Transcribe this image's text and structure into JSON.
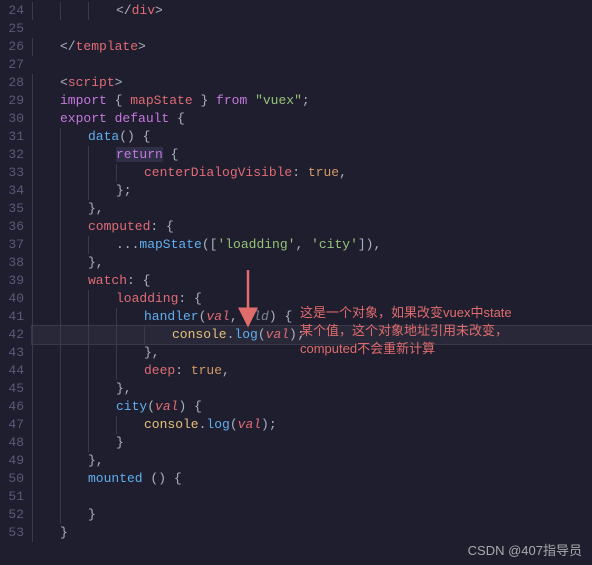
{
  "lines": [
    {
      "n": 24,
      "tokens": [
        {
          "cls": "tok-punct",
          "t": "</"
        },
        {
          "cls": "tok-tag",
          "t": "div"
        },
        {
          "cls": "tok-punct",
          "t": ">"
        }
      ],
      "indent": 3
    },
    {
      "n": 25,
      "tokens": [],
      "indent": 0
    },
    {
      "n": 26,
      "tokens": [
        {
          "cls": "tok-punct",
          "t": "</"
        },
        {
          "cls": "tok-tag",
          "t": "template"
        },
        {
          "cls": "tok-punct",
          "t": ">"
        }
      ],
      "indent": 1
    },
    {
      "n": 27,
      "tokens": [],
      "indent": 0
    },
    {
      "n": 28,
      "tokens": [
        {
          "cls": "tok-punct",
          "t": "<"
        },
        {
          "cls": "tok-tag",
          "t": "script"
        },
        {
          "cls": "tok-punct",
          "t": ">"
        }
      ],
      "indent": 1
    },
    {
      "n": 29,
      "tokens": [
        {
          "cls": "tok-keyword-purple",
          "t": "import"
        },
        {
          "cls": "tok-punct",
          "t": " { "
        },
        {
          "cls": "tok-prop",
          "t": "mapState"
        },
        {
          "cls": "tok-punct",
          "t": " } "
        },
        {
          "cls": "tok-keyword-purple",
          "t": "from"
        },
        {
          "cls": "tok-punct",
          "t": " "
        },
        {
          "cls": "tok-string",
          "t": "\"vuex\""
        },
        {
          "cls": "tok-punct",
          "t": ";"
        }
      ],
      "indent": 1
    },
    {
      "n": 30,
      "tokens": [
        {
          "cls": "tok-keyword-purple",
          "t": "export"
        },
        {
          "cls": "tok-punct",
          "t": " "
        },
        {
          "cls": "tok-keyword-purple",
          "t": "default"
        },
        {
          "cls": "tok-punct",
          "t": " {"
        }
      ],
      "indent": 1
    },
    {
      "n": 31,
      "tokens": [
        {
          "cls": "tok-func",
          "t": "data"
        },
        {
          "cls": "tok-punct",
          "t": "() {"
        }
      ],
      "indent": 2
    },
    {
      "n": 32,
      "tokens": [
        {
          "cls": "tok-keyword-purple",
          "t": "return",
          "sel": true
        },
        {
          "cls": "tok-punct",
          "t": " {"
        }
      ],
      "indent": 3
    },
    {
      "n": 33,
      "tokens": [
        {
          "cls": "tok-prop",
          "t": "centerDialogVisible"
        },
        {
          "cls": "tok-punct",
          "t": ": "
        },
        {
          "cls": "tok-bool",
          "t": "true"
        },
        {
          "cls": "tok-punct",
          "t": ","
        }
      ],
      "indent": 4
    },
    {
      "n": 34,
      "tokens": [
        {
          "cls": "tok-punct",
          "t": "};"
        }
      ],
      "indent": 3
    },
    {
      "n": 35,
      "tokens": [
        {
          "cls": "tok-punct",
          "t": "},"
        }
      ],
      "indent": 2
    },
    {
      "n": 36,
      "tokens": [
        {
          "cls": "tok-prop",
          "t": "computed"
        },
        {
          "cls": "tok-punct",
          "t": ": {"
        }
      ],
      "indent": 2
    },
    {
      "n": 37,
      "tokens": [
        {
          "cls": "tok-punct",
          "t": "..."
        },
        {
          "cls": "tok-func",
          "t": "mapState"
        },
        {
          "cls": "tok-punct",
          "t": "(["
        },
        {
          "cls": "tok-string",
          "t": "'loadding'"
        },
        {
          "cls": "tok-punct",
          "t": ", "
        },
        {
          "cls": "tok-string",
          "t": "'city'"
        },
        {
          "cls": "tok-punct",
          "t": "]),"
        }
      ],
      "indent": 3
    },
    {
      "n": 38,
      "tokens": [
        {
          "cls": "tok-punct",
          "t": "},"
        }
      ],
      "indent": 2
    },
    {
      "n": 39,
      "tokens": [
        {
          "cls": "tok-prop",
          "t": "watch"
        },
        {
          "cls": "tok-punct",
          "t": ": {"
        }
      ],
      "indent": 2
    },
    {
      "n": 40,
      "tokens": [
        {
          "cls": "tok-prop",
          "t": "loadding"
        },
        {
          "cls": "tok-punct",
          "t": ": {"
        }
      ],
      "indent": 3
    },
    {
      "n": 41,
      "tokens": [
        {
          "cls": "tok-func",
          "t": "handler"
        },
        {
          "cls": "tok-punct",
          "t": "("
        },
        {
          "cls": "tok-param",
          "t": "val"
        },
        {
          "cls": "tok-punct",
          "t": ", "
        },
        {
          "cls": "tok-paramgray",
          "t": "old"
        },
        {
          "cls": "tok-punct",
          "t": ") {"
        }
      ],
      "indent": 4
    },
    {
      "n": 42,
      "tokens": [
        {
          "cls": "tok-obj",
          "t": "console"
        },
        {
          "cls": "tok-punct",
          "t": "."
        },
        {
          "cls": "tok-func",
          "t": "log"
        },
        {
          "cls": "tok-punct",
          "t": "("
        },
        {
          "cls": "tok-param",
          "t": "val"
        },
        {
          "cls": "tok-punct",
          "t": ");"
        }
      ],
      "indent": 5,
      "hl": true
    },
    {
      "n": 43,
      "tokens": [
        {
          "cls": "tok-punct",
          "t": "},"
        }
      ],
      "indent": 4
    },
    {
      "n": 44,
      "tokens": [
        {
          "cls": "tok-prop",
          "t": "deep"
        },
        {
          "cls": "tok-punct",
          "t": ": "
        },
        {
          "cls": "tok-bool",
          "t": "true"
        },
        {
          "cls": "tok-punct",
          "t": ","
        }
      ],
      "indent": 4
    },
    {
      "n": 45,
      "tokens": [
        {
          "cls": "tok-punct",
          "t": "},"
        }
      ],
      "indent": 3
    },
    {
      "n": 46,
      "tokens": [
        {
          "cls": "tok-func",
          "t": "city"
        },
        {
          "cls": "tok-punct",
          "t": "("
        },
        {
          "cls": "tok-param",
          "t": "val"
        },
        {
          "cls": "tok-punct",
          "t": ") {"
        }
      ],
      "indent": 3
    },
    {
      "n": 47,
      "tokens": [
        {
          "cls": "tok-obj",
          "t": "console"
        },
        {
          "cls": "tok-punct",
          "t": "."
        },
        {
          "cls": "tok-func",
          "t": "log"
        },
        {
          "cls": "tok-punct",
          "t": "("
        },
        {
          "cls": "tok-param",
          "t": "val"
        },
        {
          "cls": "tok-punct",
          "t": ");"
        }
      ],
      "indent": 4
    },
    {
      "n": 48,
      "tokens": [
        {
          "cls": "tok-punct",
          "t": "}"
        }
      ],
      "indent": 3
    },
    {
      "n": 49,
      "tokens": [
        {
          "cls": "tok-punct",
          "t": "},"
        }
      ],
      "indent": 2
    },
    {
      "n": 50,
      "tokens": [
        {
          "cls": "tok-func",
          "t": "mounted"
        },
        {
          "cls": "tok-punct",
          "t": " () {"
        }
      ],
      "indent": 2
    },
    {
      "n": 51,
      "tokens": [],
      "indent": 2
    },
    {
      "n": 52,
      "tokens": [
        {
          "cls": "tok-punct",
          "t": "}"
        }
      ],
      "indent": 2
    },
    {
      "n": 53,
      "tokens": [
        {
          "cls": "tok-punct",
          "t": "}"
        }
      ],
      "indent": 1
    }
  ],
  "annotation": {
    "line1": "这是一个对象，如果改变vuex中state",
    "line2": "某个值，这个对象地址引用未改变，",
    "line3": "computed不会重新计算"
  },
  "watermark": "CSDN @407指导员"
}
